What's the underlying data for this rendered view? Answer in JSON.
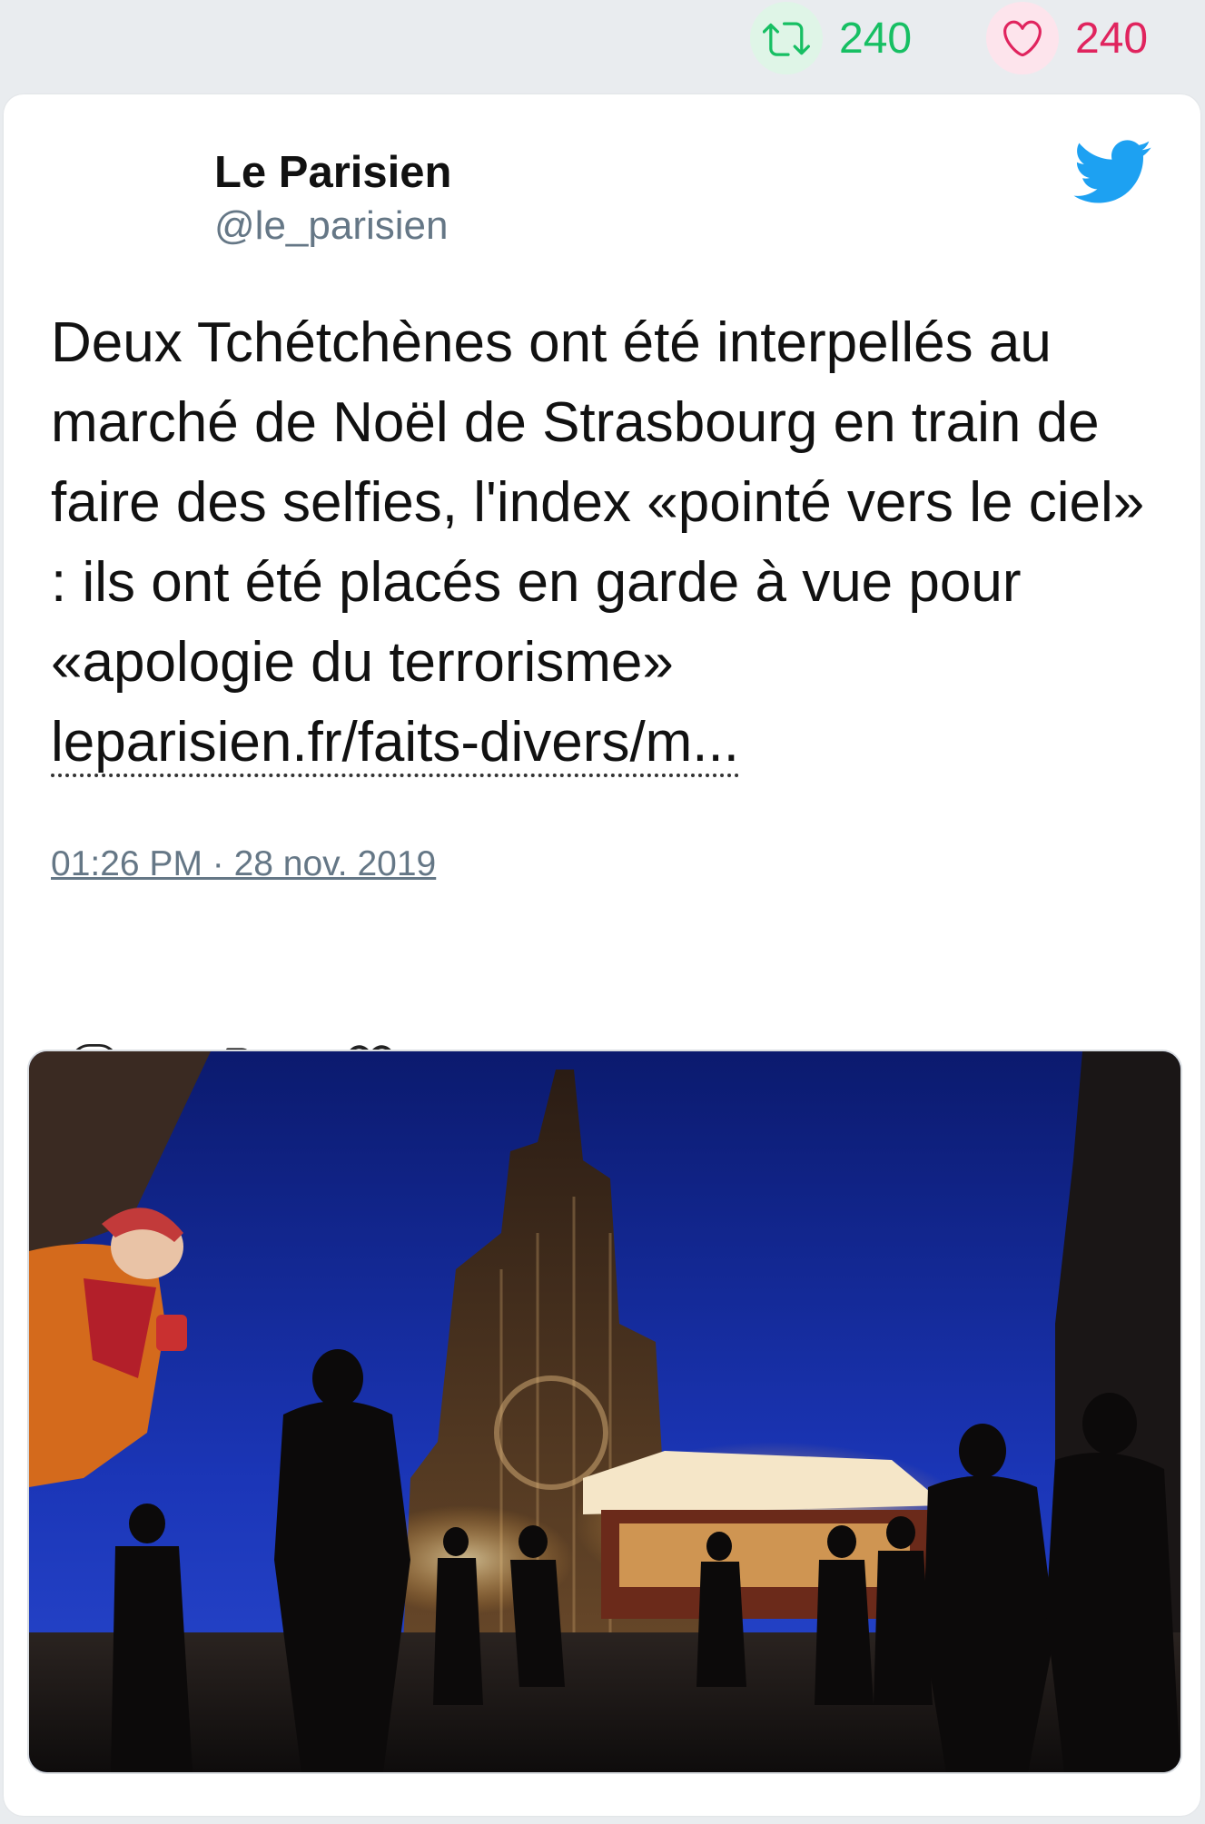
{
  "stats": {
    "retweets": "240",
    "likes": "240",
    "retweet_icon": "retweet-icon",
    "like_icon": "heart-icon"
  },
  "tweet": {
    "author_name": "Le Parisien",
    "author_handle": "@le_parisien",
    "text": "Deux Tchétchènes ont été interpellés au marché de Noël de Strasbourg en train de faire des selfies, l'index «pointé vers le ciel» : ils ont été placés en garde à vue pour «apologie du terrorisme» ",
    "link": "leparisien.fr/faits-divers/m...",
    "timestamp": "01:26 PM · 28 nov. 2019",
    "platform_icon": "twitter-bird-icon"
  },
  "actions": [
    "reply-icon",
    "retweet-icon",
    "like-icon"
  ],
  "colors": {
    "retweet": "#17bf63",
    "like": "#e0245e",
    "twitter_blue": "#1da1f2",
    "muted": "#657786"
  }
}
